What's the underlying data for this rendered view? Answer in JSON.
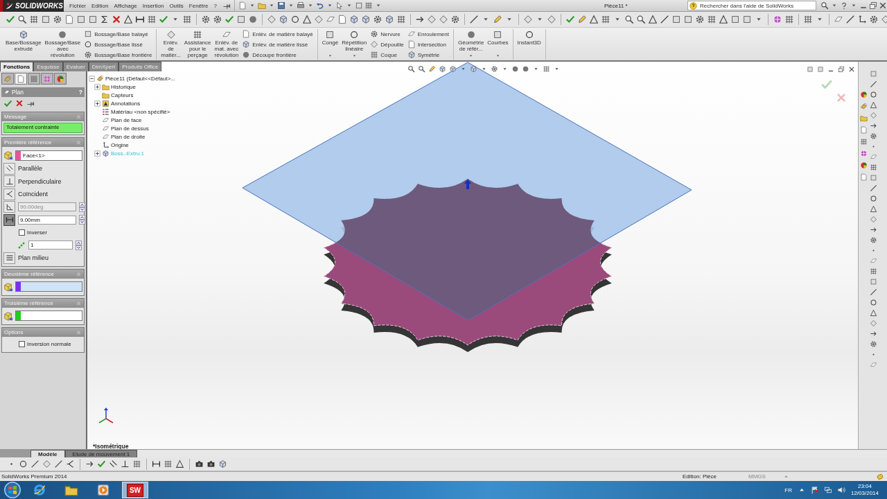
{
  "title_bar": {
    "logo": "SOLIDWORKS",
    "menu": [
      "Fichier",
      "Edition",
      "Affichage",
      "Insertion",
      "Outils",
      "Fenêtre",
      "?"
    ],
    "document_title": "Pièce11 *",
    "search": {
      "placeholder": "Rechercher dans l'aide de SolidWorks"
    }
  },
  "ribbon": {
    "groups": [
      [
        {
          "kind": "large",
          "label": "Base/Bossage\nextrudé"
        },
        {
          "kind": "large",
          "label": "Bossage/Base\navec\nrévolution"
        },
        {
          "kind": "stack",
          "items": [
            "Bossage/Base balayé",
            "Bossage/Base lissé",
            "Bossage/Base frontière"
          ]
        }
      ],
      [
        {
          "kind": "large",
          "label": "Enlèv.\nde\nmatièr..."
        },
        {
          "kind": "large",
          "label": "Assistance\npour le\nperçage"
        },
        {
          "kind": "large",
          "label": "Enlèv. de\nmat. avec\nrévolution"
        },
        {
          "kind": "stack",
          "items": [
            "Enlèv. de matière balayé",
            "Enlèv. de matière lissé",
            "Découpe frontière"
          ]
        }
      ],
      [
        {
          "kind": "large",
          "label": "Congé",
          "has_menu": true
        },
        {
          "kind": "large",
          "label": "Répétition\nlinéaire",
          "has_menu": true
        },
        {
          "kind": "stack",
          "items": [
            "Nervure",
            "Dépouille",
            "Coque"
          ]
        },
        {
          "kind": "stack",
          "items": [
            "Enroulement",
            "Intersection",
            "Symétrie"
          ]
        }
      ],
      [
        {
          "kind": "large",
          "label": "Géométrie\nde référ...",
          "has_menu": true
        },
        {
          "kind": "large",
          "label": "Courbes",
          "has_menu": true
        }
      ],
      [
        {
          "kind": "large",
          "label": "Instant3D"
        }
      ]
    ]
  },
  "command_tabs": [
    {
      "label": "Fonctions",
      "selected": true
    },
    {
      "label": "Esquisse",
      "selected": false
    },
    {
      "label": "Evaluer",
      "selected": false
    },
    {
      "label": "DimXpert",
      "selected": false
    },
    {
      "label": "Produits Office",
      "selected": false
    }
  ],
  "property_manager": {
    "manager_tabs": [
      {
        "selected": false
      },
      {
        "selected": true
      },
      {
        "selected": false
      },
      {
        "selected": false
      },
      {
        "selected": false
      }
    ],
    "title": "Plan",
    "help": "?",
    "sections": [
      {
        "kind": "message",
        "title": "Message",
        "expanded": true,
        "text": "Totalement contrainte"
      },
      {
        "kind": "reference",
        "title": "Première référence",
        "expanded": true,
        "selection": {
          "value": "Face<1>",
          "color": "#e8559e",
          "active": false
        },
        "constraints": [
          {
            "kind": "toggle",
            "label": "Parallèle",
            "selected": false
          },
          {
            "kind": "toggle",
            "label": "Perpendiculaire",
            "selected": false
          },
          {
            "kind": "toggle",
            "label": "Coïncident",
            "selected": false
          },
          {
            "kind": "spin",
            "value": "90.00deg",
            "selected": false,
            "disabled": true
          },
          {
            "kind": "spin",
            "value": "9.00mm",
            "selected": true,
            "disabled": false
          },
          {
            "kind": "checkbox",
            "label": "Inverser",
            "checked": false
          },
          {
            "kind": "count",
            "value": "1"
          },
          {
            "kind": "toggle",
            "label": "Plan milieu",
            "selected": false
          }
        ]
      },
      {
        "kind": "reference",
        "title": "Deuxième référence",
        "expanded": true,
        "selection": {
          "color": "#7b2ff0",
          "active": true
        }
      },
      {
        "kind": "reference",
        "title": "Troisième référence",
        "expanded": true,
        "selection": {
          "color": "#22cc22",
          "active": false
        }
      },
      {
        "kind": "options",
        "title": "Options",
        "expanded": true,
        "checkboxes": [
          {
            "label": "Inversion normale",
            "checked": false
          }
        ]
      }
    ]
  },
  "feature_tree": {
    "root": {
      "label": "Pièce11  (Défaut<<Défaut>...",
      "kind": "part",
      "expanded": true,
      "selected": false,
      "children": [
        {
          "label": "Historique",
          "kind": "history",
          "expanded": false,
          "selected": false
        },
        {
          "label": "Capteurs",
          "kind": "sensors",
          "selected": false
        },
        {
          "label": "Annotations",
          "kind": "annotations",
          "expanded": false,
          "selected": false
        },
        {
          "label": "Matériau <non spécifié>",
          "kind": "material",
          "selected": false
        },
        {
          "label": "Plan de face",
          "kind": "plane",
          "selected": false
        },
        {
          "label": "Plan de dessus",
          "kind": "plane",
          "selected": false
        },
        {
          "label": "Plan de droite",
          "kind": "plane",
          "selected": false
        },
        {
          "label": "Origine",
          "kind": "origin",
          "selected": false
        },
        {
          "label": "Boss.-Extru.1",
          "kind": "feature",
          "expanded": false,
          "selected": true
        }
      ]
    }
  },
  "viewport": {
    "view_label": "*Isométrique"
  },
  "bottom_tabs": [
    {
      "label": "Modèle",
      "selected": true
    },
    {
      "label": "Etude de mouvement 1",
      "selected": false
    }
  ],
  "status_bar": {
    "product": "SolidWorks Premium 2014",
    "mode": "Edition: Pièce",
    "units": "MMGS"
  },
  "taskbar": {
    "apps": [
      {
        "kind": "browser",
        "active": false
      },
      {
        "kind": "folder",
        "active": false
      },
      {
        "kind": "media",
        "active": false
      },
      {
        "kind": "solidworks",
        "label": "SW",
        "active": true
      }
    ],
    "language": "FR",
    "time": "23:04",
    "date": "12/03/2014"
  }
}
